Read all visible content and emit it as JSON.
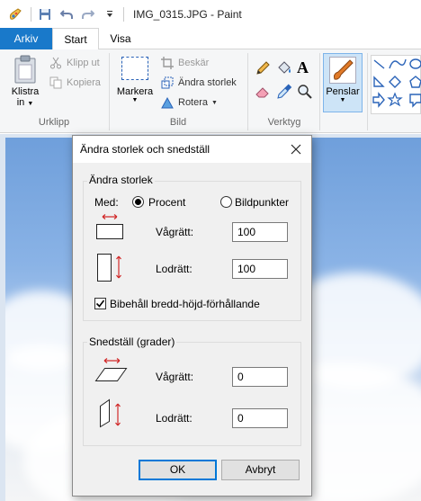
{
  "window": {
    "title": "IMG_0315.JPG - Paint"
  },
  "tabs": {
    "arkiv": "Arkiv",
    "start": "Start",
    "visa": "Visa"
  },
  "ribbon": {
    "clipboard": {
      "paste_label_1": "Klistra",
      "paste_label_2": "in",
      "cut": "Klipp ut",
      "copy": "Kopiera",
      "group": "Urklipp"
    },
    "image": {
      "select_label": "Markera",
      "crop": "Beskär",
      "resize": "Ändra storlek",
      "rotate": "Rotera",
      "group": "Bild"
    },
    "tools": {
      "group": "Verktyg"
    },
    "brushes": {
      "label": "Penslar"
    }
  },
  "dialog": {
    "title": "Ändra storlek och snedställ",
    "resize": {
      "legend": "Ändra storlek",
      "by_label": "Med:",
      "percent_option": "Procent",
      "pixels_option": "Bildpunkter",
      "selected_unit": "Procent",
      "horizontal_label": "Vågrätt:",
      "horizontal_value": "100",
      "vertical_label": "Lodrätt:",
      "vertical_value": "100",
      "keep_ratio_label": "Bibehåll bredd-höjd-förhållande",
      "keep_ratio_checked": true
    },
    "skew": {
      "legend": "Snedställ (grader)",
      "horizontal_label": "Vågrätt:",
      "horizontal_value": "0",
      "vertical_label": "Lodrätt:",
      "vertical_value": "0"
    },
    "ok": "OK",
    "cancel": "Avbryt"
  },
  "colors": {
    "accent": "#1979ca",
    "arrow_red": "#d12a2a",
    "focus_border": "#0078d7"
  }
}
